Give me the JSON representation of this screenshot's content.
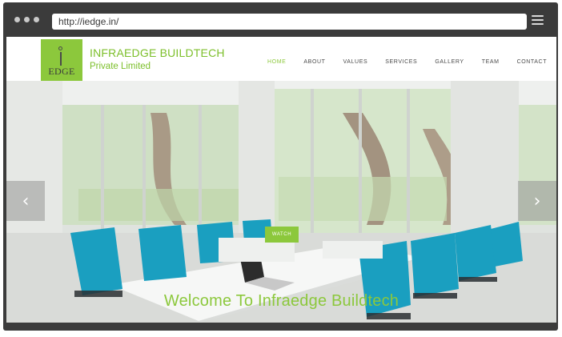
{
  "browser": {
    "url": "http://iedge.in/"
  },
  "logo": {
    "edge_text": "EDGE"
  },
  "brand": {
    "name_line1": "INFRAEDGE BUILDTECH",
    "name_line2": "Private Limited"
  },
  "nav": {
    "items": [
      {
        "label": "HOME",
        "active": true
      },
      {
        "label": "ABOUT"
      },
      {
        "label": "VALUES"
      },
      {
        "label": "SERVICES"
      },
      {
        "label": "GALLERY"
      },
      {
        "label": "TEAM"
      },
      {
        "label": "CONTACT"
      }
    ]
  },
  "hero": {
    "prev_arrow": "‹",
    "next_arrow": "›",
    "watch_label": "WATCH",
    "welcome_text": "Welcome To Infraedge Buildtech"
  },
  "colors": {
    "accent": "#8cc83c",
    "chrome": "#3b3b3b",
    "chair": "#1a9fc0"
  },
  "icons": [
    "window-dot-icon",
    "menu-icon",
    "chevron-left-icon",
    "chevron-right-icon",
    "logo-i-icon"
  ]
}
